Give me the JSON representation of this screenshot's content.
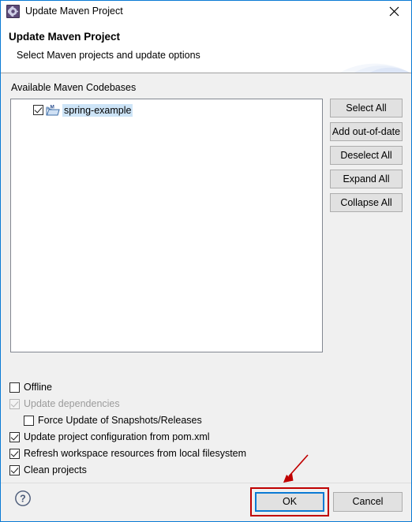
{
  "window": {
    "title": "Update Maven Project",
    "title_icon": "maven-gear-icon",
    "close_icon": "close-icon",
    "border_color": "#0a7ad4"
  },
  "header": {
    "title": "Update Maven Project",
    "subtitle": "Select Maven projects and update options"
  },
  "tree": {
    "label": "Available Maven Codebases",
    "items": [
      {
        "name": "spring-example",
        "checked": true,
        "selected": true,
        "icon": "maven-project-folder-icon"
      }
    ]
  },
  "side_buttons": [
    {
      "label": "Select All"
    },
    {
      "label": "Add out-of-date"
    },
    {
      "label": "Deselect All"
    },
    {
      "label": "Expand All"
    },
    {
      "label": "Collapse All"
    }
  ],
  "options": [
    {
      "label": "Offline",
      "checked": false,
      "enabled": true,
      "indent": 0
    },
    {
      "label": "Update dependencies",
      "checked": true,
      "enabled": false,
      "indent": 0
    },
    {
      "label": "Force Update of Snapshots/Releases",
      "checked": false,
      "enabled": true,
      "indent": 1
    },
    {
      "label": "Update project configuration from pom.xml",
      "checked": true,
      "enabled": true,
      "indent": 0
    },
    {
      "label": "Refresh workspace resources from local filesystem",
      "checked": true,
      "enabled": true,
      "indent": 0
    },
    {
      "label": "Clean projects",
      "checked": true,
      "enabled": true,
      "indent": 0
    }
  ],
  "footer": {
    "help_icon": "help-question-icon",
    "ok_label": "OK",
    "cancel_label": "Cancel"
  },
  "annotations": {
    "highlight_color": "#c00000",
    "arrow_color": "#c00000",
    "focus_color": "#0a7ad4"
  }
}
